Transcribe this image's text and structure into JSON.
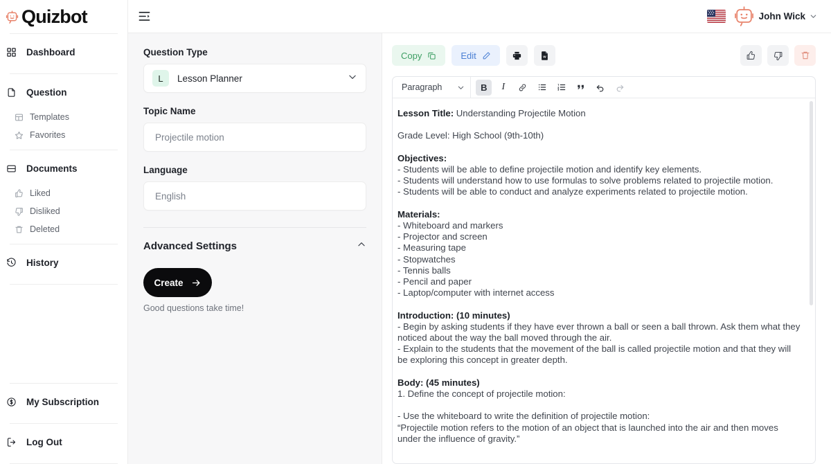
{
  "brand": {
    "name": "Quizbot",
    "logo_icon": "robot-icon",
    "accent": "#e8836b"
  },
  "topbar": {
    "collapse_icon": "sidebar-collapse-icon",
    "flag_icon": "us-flag-icon",
    "avatar_icon": "robot-avatar-icon",
    "user_name": "John Wick",
    "chevron_icon": "chevron-down-icon"
  },
  "sidebar": {
    "items": [
      {
        "label": "Dashboard",
        "icon": "grid-icon"
      },
      {
        "label": "Question",
        "icon": "file-text-icon"
      },
      {
        "label": "Templates",
        "icon": "layout-template-icon"
      },
      {
        "label": "Favorites",
        "icon": "star-icon"
      },
      {
        "label": "Documents",
        "icon": "folder-icon"
      },
      {
        "label": "Liked",
        "icon": "thumbs-up-icon"
      },
      {
        "label": "Disliked",
        "icon": "thumbs-down-icon"
      },
      {
        "label": "Deleted",
        "icon": "trash-icon"
      },
      {
        "label": "History",
        "icon": "clock-history-icon"
      },
      {
        "label": "My Subscription",
        "icon": "dollar-circle-icon"
      },
      {
        "label": "Log Out",
        "icon": "logout-icon"
      }
    ]
  },
  "form": {
    "question_type_label": "Question Type",
    "question_type_badge": "L",
    "question_type_value": "Lesson Planner",
    "topic_label": "Topic Name",
    "topic_placeholder": "Projectile motion",
    "language_label": "Language",
    "language_placeholder": "English",
    "advanced_label": "Advanced Settings",
    "advanced_chevron": "chevron-up-icon",
    "create_label": "Create",
    "create_arrow": "arrow-right-icon",
    "create_hint": "Good questions take time!"
  },
  "actions": {
    "copy_label": "Copy",
    "copy_icon": "copy-icon",
    "edit_label": "Edit",
    "edit_icon": "pencil-icon",
    "print_icon": "printer-icon",
    "word_icon": "word-document-icon",
    "like_icon": "thumbs-up-icon",
    "dislike_icon": "thumbs-down-icon",
    "delete_icon": "trash-icon"
  },
  "editor_toolbar": {
    "block_format": "Paragraph",
    "block_chevron": "chevron-down-icon",
    "bold": "B",
    "italic": "I",
    "link_icon": "link-icon",
    "bullet_list_icon": "bullet-list-icon",
    "numbered_list_icon": "numbered-list-icon",
    "quote_icon": "blockquote-icon",
    "undo_icon": "undo-icon",
    "redo_icon": "redo-icon"
  },
  "document": {
    "lesson_title_label": "Lesson Title:",
    "lesson_title_value": " Understanding Projectile Motion",
    "grade_level": "Grade Level: High School (9th-10th)",
    "objectives_heading": "Objectives:",
    "objectives": [
      "- Students will be able to define projectile motion and identify key elements.",
      "- Students will understand how to use formulas to solve problems related to projectile motion.",
      "- Students will be able to conduct and analyze experiments related to projectile motion."
    ],
    "materials_heading": "Materials:",
    "materials": [
      "- Whiteboard and markers",
      "- Projector and screen",
      "- Measuring tape",
      "- Stopwatches",
      "- Tennis balls",
      "- Pencil and paper",
      "- Laptop/computer with internet access"
    ],
    "introduction_heading": "Introduction: (10 minutes)",
    "introduction": [
      "- Begin by asking students if they have ever thrown a ball or seen a ball thrown. Ask them what they noticed about the way the ball moved through the air.",
      "- Explain to the students that the movement of the ball is called projectile motion and that they will be exploring this concept in greater depth."
    ],
    "body_heading": "Body: (45 minutes)",
    "body_intro": "1. Define the concept of projectile motion:",
    "body_lines": [
      "- Use the whiteboard to write the definition of projectile motion:",
      "“Projectile motion refers to the motion of an object that is launched into the air and then moves under the influence of gravity.”"
    ]
  }
}
